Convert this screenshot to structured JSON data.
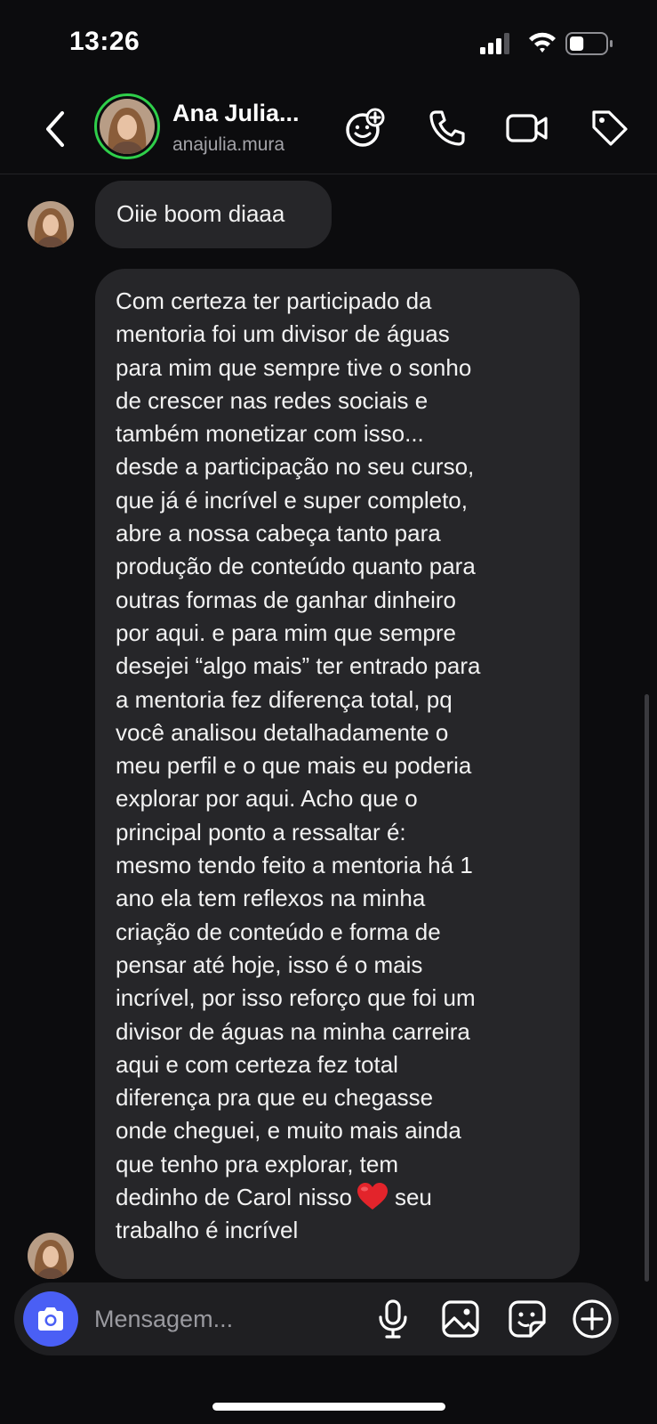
{
  "status_bar": {
    "time": "13:26",
    "battery_level": 0.4
  },
  "header": {
    "name": "Ana Julia...",
    "handle": "anajulia.mura",
    "icons": [
      "back-chevron-icon",
      "emoji-add-icon",
      "phone-icon",
      "video-camera-icon",
      "tag-icon"
    ],
    "avatar_ring_color": "#2fcf4a"
  },
  "messages": [
    {
      "text": "Oiie boom diaaa"
    },
    {
      "text_before_emoji": "Com certeza ter participado da\nmentoria foi um divisor de águas\npara mim que sempre tive o sonho\nde crescer nas redes sociais e\ntambém monetizar com isso...\ndesde a participação no seu curso,\nque já é incrível e super completo,\nabre a nossa cabeça tanto para\nprodução de conteúdo quanto para\noutras formas de ganhar dinheiro\npor aqui. e para mim que sempre\ndesejei “algo mais” ter entrado para\na mentoria fez diferença total, pq\nvocê analisou detalhadamente o\nmeu perfil e o que mais eu poderia\nexplorar por aqui. Acho que o\nprincipal ponto a ressaltar é:\nmesmo tendo feito a mentoria há 1\nano ela tem reflexos na minha\ncriação de conteúdo e forma de\npensar até hoje, isso é o mais\nincrível, por isso reforço que foi um\ndivisor de águas na minha carreira\naqui e com certeza fez total\ndiferença pra que eu chegasse\nonde cheguei, e muito mais ainda\nque tenho pra explorar, tem\ndedinho de Carol nisso",
      "emoji": "red-heart-emoji",
      "text_after_emoji": "seu\ntrabalho é incrível"
    }
  ],
  "composer": {
    "placeholder": "Mensagem...",
    "icons": [
      "camera-icon",
      "microphone-icon",
      "gallery-icon",
      "sticker-icon",
      "plus-circle-icon"
    ],
    "camera_button_color": "#4a5ff5"
  },
  "colors": {
    "background": "#0c0c0e",
    "bubble": "#262629",
    "accent": "#4a5ff5"
  }
}
